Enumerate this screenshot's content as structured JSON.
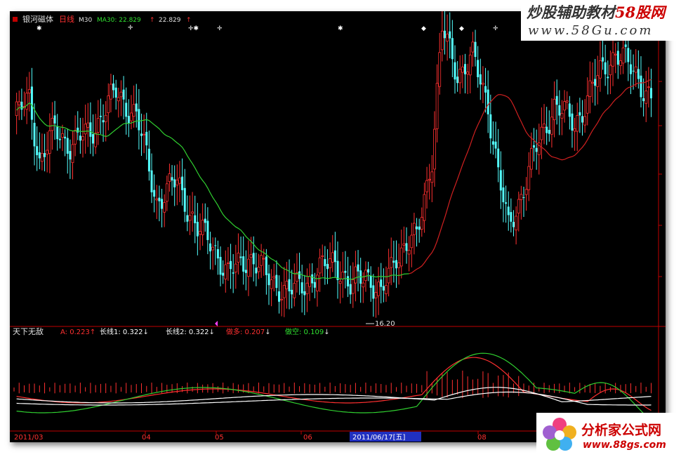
{
  "header": {
    "stock_name": "银河磁体",
    "period": "日线",
    "ma_indicator": "M30",
    "ma_label": "MA30: 22.829",
    "ma_arrow": "↑",
    "ma_value2": "22.829",
    "ma_arrow2": "↑"
  },
  "chart_data": {
    "type": "candlestick",
    "low_annotation": "16.20",
    "date_axis": {
      "ticks": [
        "2011/03",
        "04",
        "05",
        "06",
        "08"
      ],
      "highlight": "2011/06/17[五]"
    },
    "indicator": {
      "name": "天下无敌",
      "items": [
        {
          "label": "A:",
          "value": "0.223",
          "arrow": "↑",
          "color": "#ff3030"
        },
        {
          "label": "长线1:",
          "value": "0.322",
          "arrow": "↓",
          "color": "#ffffff"
        },
        {
          "label": "长线2:",
          "value": "0.322",
          "arrow": "↓",
          "color": "#ffffff"
        },
        {
          "label": "做多:",
          "value": "0.207",
          "arrow": "↓",
          "color": "#ff3030"
        },
        {
          "label": "做空:",
          "value": "0.109",
          "arrow": "↓",
          "color": "#30e030"
        }
      ]
    },
    "colors": {
      "up": "#ff3030",
      "down": "#54ffff",
      "ma30_before": "#30d030",
      "ma30_after": "#d02020",
      "axis": "#c00000"
    }
  },
  "watermarks": {
    "top_line1": "炒股辅助教材",
    "top_line1_red": "58股网",
    "top_line2": "www.58Gu.com",
    "bottom_line1": "分析家公式网",
    "bottom_line2": "www.88gs.com"
  }
}
